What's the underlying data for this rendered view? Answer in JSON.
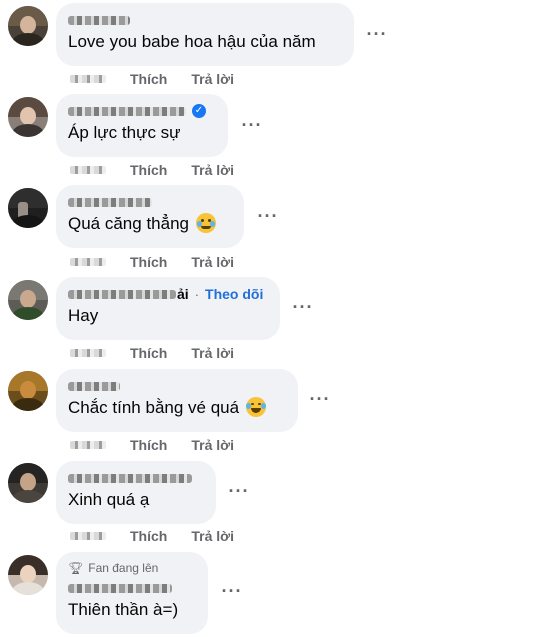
{
  "actions": {
    "like": "Thích",
    "reply": "Trả lời"
  },
  "more_icon": "more-horizontal-icon",
  "comments": [
    {
      "text": "Love you babe hoa hậu của năm",
      "avatar_color": "#4a4238"
    },
    {
      "text": "Áp lực thực sự",
      "verified": true,
      "avatar_color": "#8a7f78"
    },
    {
      "text": "Quá căng thẳng",
      "emoji": "crying-emoji",
      "avatar_color": "#1f1f1f"
    },
    {
      "text": "Hay",
      "name_suffix": "ải",
      "follow": "Theo dõi",
      "separator": "·",
      "avatar_color": "#5d5c56"
    },
    {
      "text": "Chắc tính bằng vé quá",
      "emoji": "laughing-tears-emoji",
      "avatar_color": "#6b4d1c"
    },
    {
      "text": "Xinh quá ạ",
      "avatar_color": "#3d3a36"
    },
    {
      "text": "Thiên thần à=)",
      "badge": "Fan đang lên",
      "badge_icon": "trophy-icon",
      "avatar_color": "#c7b8ad"
    }
  ]
}
